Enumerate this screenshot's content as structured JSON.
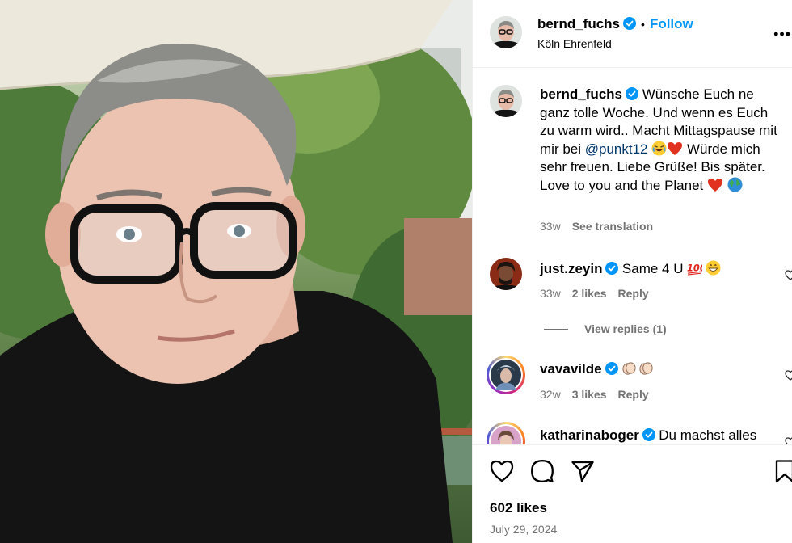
{
  "post": {
    "username": "bernd_fuchs",
    "follow_label": "Follow",
    "location": "Köln Ehrenfeld",
    "caption_part1": "Wünsche Euch ne ganz tolle Woche. Und wenn es Euch zu warm wird.. Macht Mittagspause mit mir bei ",
    "mention": "@punkt12",
    "caption_part2": " Würde mich sehr freuen. Liebe Grüße! Bis später. Love to you and the Planet",
    "time": "33w",
    "see_translation": "See translation",
    "likes": "602 likes",
    "date": "July 29, 2024"
  },
  "comments": [
    {
      "username": "just.zeyin",
      "text": "Same 4 U",
      "time": "33w",
      "likes": "2 likes",
      "reply": "Reply",
      "view_replies": "View replies (1)"
    },
    {
      "username": "vavavilde",
      "text": "",
      "time": "32w",
      "likes": "3 likes",
      "reply": "Reply"
    },
    {
      "username": "katharinaboger",
      "text": "Du machst alles"
    }
  ],
  "icons": {
    "more": "more-options-icon",
    "like": "heart-icon",
    "comment": "comment-icon",
    "share": "share-icon",
    "save": "bookmark-icon"
  },
  "colors": {
    "link": "#0095f6",
    "mention": "#00376b",
    "muted": "#737373",
    "verified": "#0095f6"
  }
}
